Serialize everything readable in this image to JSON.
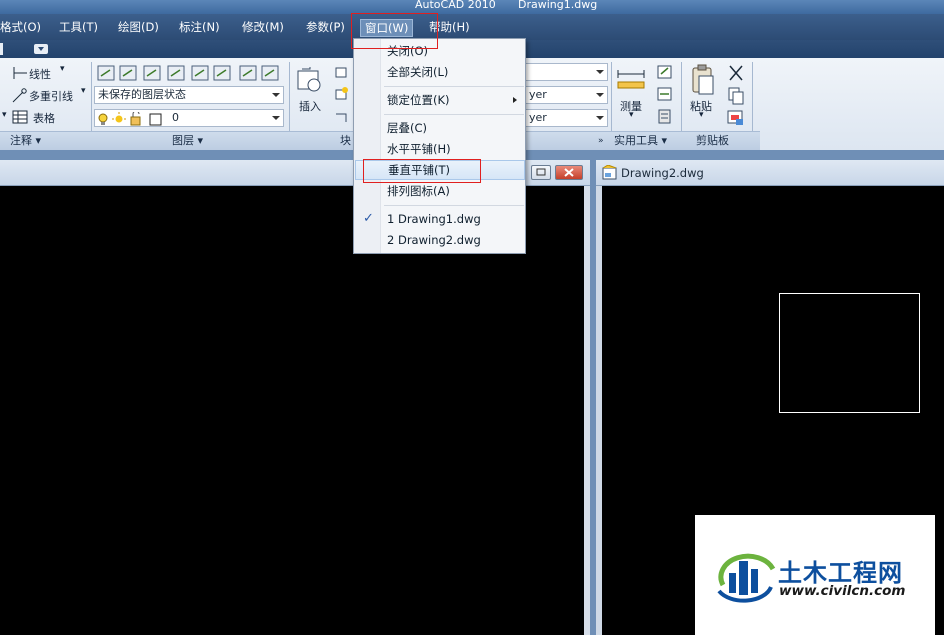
{
  "titlebar": {
    "app_title": "AutoCAD 2010",
    "doc_title": "Drawing1.dwg"
  },
  "menubar": {
    "items": [
      "格式(O)",
      "工具(T)",
      "绘图(D)",
      "标注(N)",
      "修改(M)",
      "参数(P)",
      "窗口(W)",
      "帮助(H)"
    ],
    "active": "窗口(W)"
  },
  "ribbon": {
    "annotate": {
      "linear": "线性",
      "mleader": "多重引线",
      "table": "表格",
      "title": "注释"
    },
    "layers": {
      "layer_state": "未保存的图层状态",
      "current_layer": "0",
      "title": "图层"
    },
    "block": {
      "insert": "插入",
      "title": "块"
    },
    "properties": {
      "bylayer_1": "yer",
      "bylayer_2": "yer"
    },
    "utilities": {
      "measure": "测量",
      "title": "实用工具"
    },
    "clipboard": {
      "paste": "粘贴",
      "title": "剪贴板"
    }
  },
  "windows": [
    {
      "title": "Drawing1.dwg"
    },
    {
      "title": "Drawing2.dwg"
    }
  ],
  "window_menu": {
    "items": [
      {
        "label": "关闭(O)"
      },
      {
        "label": "全部关闭(L)"
      },
      {
        "label": "锁定位置(K)",
        "submenu": true
      },
      {
        "label": "层叠(C)"
      },
      {
        "label": "水平平铺(H)"
      },
      {
        "label": "垂直平铺(T)",
        "highlighted": true
      },
      {
        "label": "排列图标(A)"
      },
      {
        "label": "1 Drawing1.dwg",
        "checked": true
      },
      {
        "label": "2 Drawing2.dwg"
      }
    ]
  },
  "watermark": {
    "title": "土木工程网",
    "url": "www.civilcn.com"
  },
  "colors": {
    "menubar": "#2c4b74",
    "annotation_red": "#e02020",
    "watermark_blue": "#0d4f9e",
    "watermark_green": "#6cb33e"
  }
}
